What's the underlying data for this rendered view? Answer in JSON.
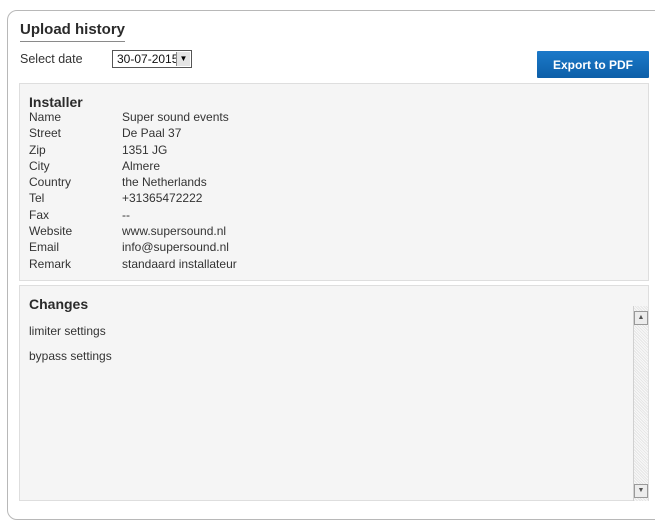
{
  "page": {
    "title": "Upload history",
    "select_date_label": "Select date",
    "selected_date": "30-07-2015",
    "export_label": "Export to PDF"
  },
  "installer": {
    "heading": "Installer",
    "rows": [
      {
        "label": "Name",
        "value": "Super sound events"
      },
      {
        "label": "Street",
        "value": "De Paal 37"
      },
      {
        "label": "Zip",
        "value": "1351 JG"
      },
      {
        "label": "City",
        "value": "Almere"
      },
      {
        "label": "Country",
        "value": "the Netherlands"
      },
      {
        "label": "Tel",
        "value": "+31365472222"
      },
      {
        "label": "Fax",
        "value": "--"
      },
      {
        "label": "Website",
        "value": "www.supersound.nl"
      },
      {
        "label": "Email",
        "value": "info@supersound.nl"
      },
      {
        "label": "Remark",
        "value": "standaard installateur"
      }
    ]
  },
  "changes": {
    "heading": "Changes",
    "items": [
      "limiter settings",
      "bypass settings"
    ]
  },
  "icons": {
    "dropdown": "chevron-down-icon",
    "scroll_up": "arrow-up-icon",
    "scroll_down": "arrow-down-icon"
  }
}
